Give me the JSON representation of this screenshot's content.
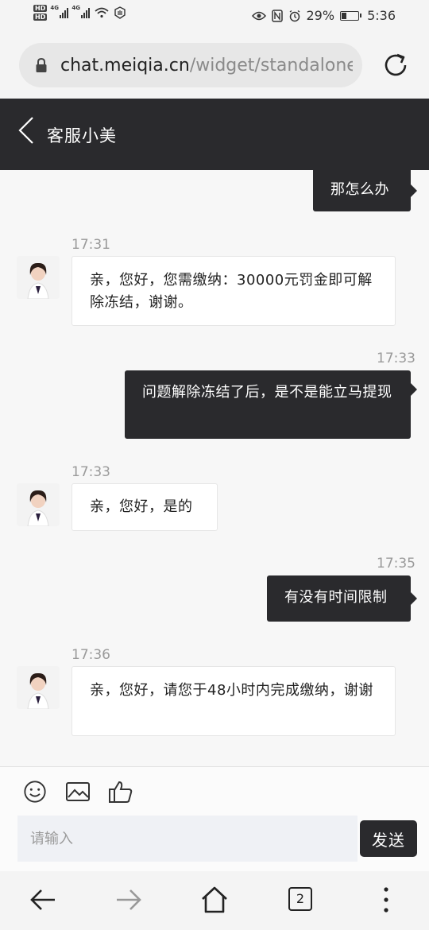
{
  "status_bar": {
    "network_badges": [
      "HD",
      "HD"
    ],
    "signal_labels": [
      "4G",
      "4G"
    ],
    "battery_percent": "29%",
    "time": "5:36"
  },
  "browser": {
    "url_host": "chat.meiqia.cn",
    "url_path": "/widget/standalone",
    "tabs_count": "2"
  },
  "chat": {
    "title": "客服小美",
    "messages": [
      {
        "side": "out",
        "time": "",
        "text": "那怎么办"
      },
      {
        "side": "in",
        "time": "17:31",
        "text": "亲，您好，您需缴纳：30000元罚金即可解除冻结，谢谢。"
      },
      {
        "side": "out",
        "time": "17:33",
        "text": "问题解除冻结了后，是不是能立马提现"
      },
      {
        "side": "in",
        "time": "17:33",
        "text": "亲，您好，是的"
      },
      {
        "side": "out",
        "time": "17:35",
        "text": "有没有时间限制"
      },
      {
        "side": "in",
        "time": "17:36",
        "text": "亲，您好，请您于48小时内完成缴纳，谢谢"
      }
    ]
  },
  "composer": {
    "placeholder": "请输入",
    "send_label": "发送",
    "tools": [
      "emoji-icon",
      "image-icon",
      "thumbs-up-icon"
    ]
  },
  "colors": {
    "header_bg": "#2a2a2d",
    "outgoing_bubble": "#2a2a2d",
    "incoming_bubble": "#ffffff",
    "timestamp": "#9a9a9a"
  }
}
